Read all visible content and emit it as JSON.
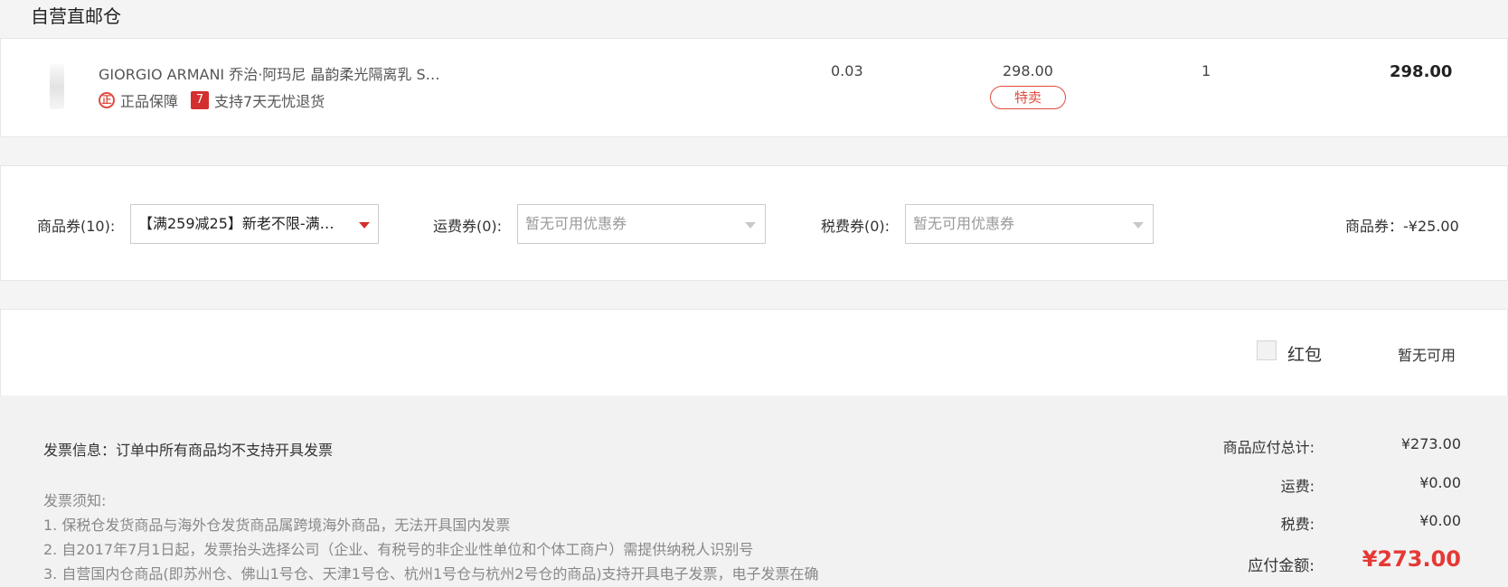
{
  "section": {
    "title": "自营直邮仓"
  },
  "product": {
    "name": "GIORGIO ARMANI 乔治·阿玛尼 晶韵柔光隔离乳 S…",
    "badge_genuine_icon": "正",
    "badge_genuine": "正品保障",
    "badge_return_icon": "7",
    "badge_return": "支持7天无忧退货",
    "tax": "0.03",
    "price": "298.00",
    "tag": "特卖",
    "quantity": "1",
    "subtotal": "298.00"
  },
  "coupons": {
    "goods_label": "商品券(10):",
    "goods_value": "【满259减25】新老不限-满…",
    "shipping_label": "运费券(0):",
    "shipping_placeholder": "暂无可用优惠券",
    "tax_label": "税费券(0):",
    "tax_placeholder": "暂无可用优惠券",
    "discount_summary": "商品券：-¥25.00"
  },
  "redpacket": {
    "label": "红包",
    "status": "暂无可用"
  },
  "invoice": {
    "info": "发票信息：订单中所有商品均不支持开具发票",
    "notice_title": "发票须知:",
    "notices": [
      "1. 保税仓发货商品与海外仓发货商品属跨境海外商品，无法开具国内发票",
      "2. 自2017年7月1日起，发票抬头选择公司（企业、有税号的非企业性单位和个体工商户）需提供纳税人识别号",
      "3. 自营国内仓商品(即苏州仓、佛山1号仓、天津1号仓、杭州1号仓与杭州2号仓的商品)支持开具电子发票，电子发票在确"
    ]
  },
  "totals": {
    "goods_label": "商品应付总计:",
    "goods_value": "¥273.00",
    "shipping_label": "运费:",
    "shipping_value": "¥0.00",
    "tax_label": "税费:",
    "tax_value": "¥0.00",
    "payable_label": "应付金额:",
    "payable_value": "¥273.00"
  },
  "colors": {
    "accent_red": "#e53935",
    "tag_red": "#e04b3f"
  }
}
